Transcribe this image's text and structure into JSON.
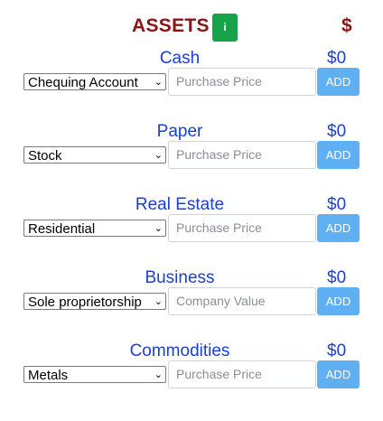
{
  "header": {
    "title": "ASSETS",
    "info_label": "i",
    "currency": "$"
  },
  "sections": [
    {
      "title": "Cash",
      "total": "$0",
      "selected": "Chequing Account",
      "placeholder": "Purchase Price",
      "add_label": "ADD"
    },
    {
      "title": "Paper",
      "total": "$0",
      "selected": "Stock",
      "placeholder": "Purchase Price",
      "add_label": "ADD"
    },
    {
      "title": "Real Estate",
      "total": "$0",
      "selected": "Residential",
      "placeholder": "Purchase Price",
      "add_label": "ADD"
    },
    {
      "title": "Business",
      "total": "$0",
      "selected": "Sole proprietorship",
      "placeholder": "Company Value",
      "add_label": "ADD"
    },
    {
      "title": "Commodities",
      "total": "$0",
      "selected": "Metals",
      "placeholder": "Purchase Price",
      "add_label": "ADD"
    }
  ],
  "icons": {
    "select_chevron": "chevron-down-icon"
  },
  "colors": {
    "header_text": "#8b1414",
    "info_button": "#16a34a",
    "section_text": "#1a3fd6",
    "add_button": "#5fb0f3"
  }
}
